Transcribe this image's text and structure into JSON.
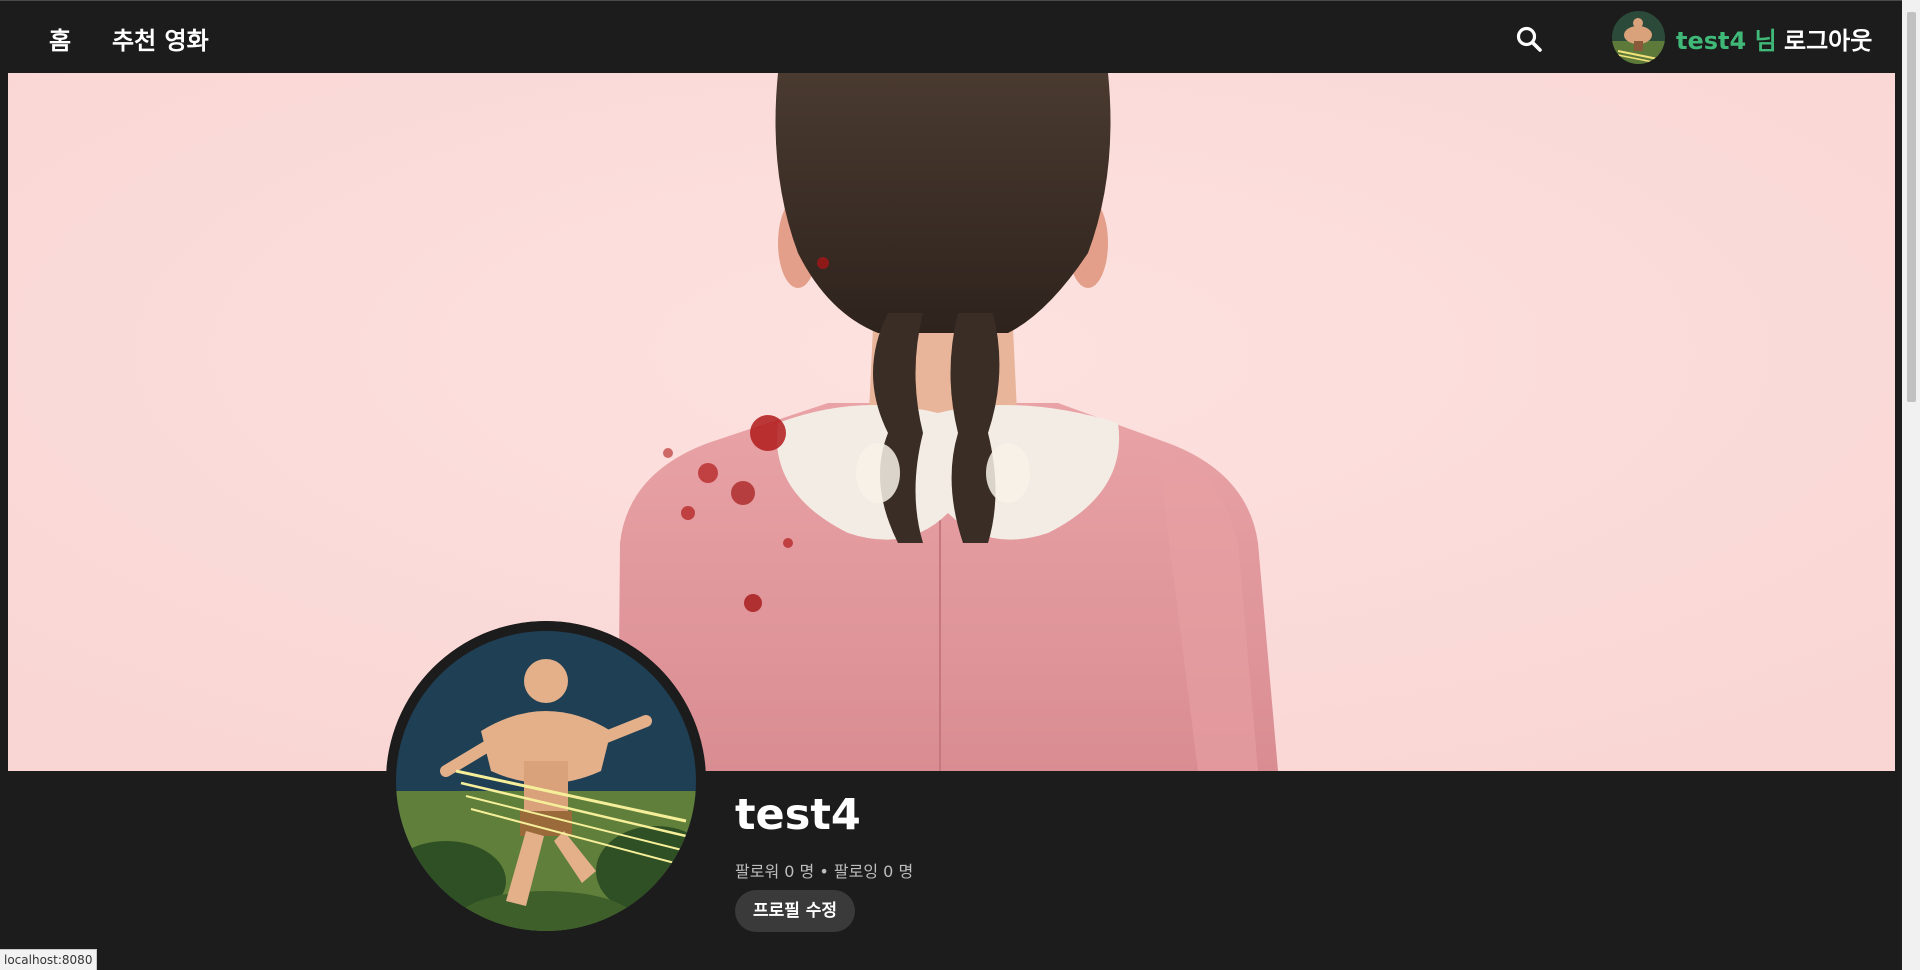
{
  "navbar": {
    "home_label": "홈",
    "recommend_label": "추천 영화",
    "username_label": "test4 님",
    "logout_label": "로그아웃"
  },
  "profile": {
    "name": "test4",
    "followers_label": "팔로워",
    "followers_count": "0",
    "followers_unit": "명",
    "separator": "•",
    "following_label": "팔로잉",
    "following_count": "0",
    "following_unit": "명",
    "edit_button": "프로필 수정"
  },
  "status_bar": {
    "url": "localhost:8080"
  },
  "colors": {
    "background": "#1c1c1c",
    "username_accent": "#3fb878",
    "banner_background": "#fcdcdb",
    "edit_button_bg": "#3a3a3a"
  },
  "icons": {
    "search": "search-icon"
  }
}
